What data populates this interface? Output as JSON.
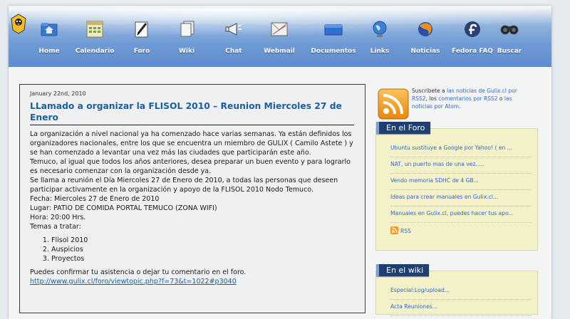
{
  "nav": {
    "items": [
      {
        "label": "Home",
        "icon": "home-icon"
      },
      {
        "label": "Calendario",
        "icon": "calendar-icon"
      },
      {
        "label": "Foro",
        "icon": "pencil-icon"
      },
      {
        "label": "Wiki",
        "icon": "documents-icon"
      },
      {
        "label": "Chat",
        "icon": "megaphone-icon"
      },
      {
        "label": "Webmail",
        "icon": "mail-icon"
      },
      {
        "label": "Documentos",
        "icon": "folder-icon"
      },
      {
        "label": "Links",
        "icon": "globe-icon"
      },
      {
        "label": "Noticias",
        "icon": "firefox-icon"
      },
      {
        "label": "Fedora FAQ",
        "icon": "fedora-icon"
      },
      {
        "label": "Buscar",
        "icon": "binoculars-icon"
      }
    ]
  },
  "post": {
    "date": "January 22nd, 2010",
    "title": "LLamado a organizar la FLISOL 2010 – Reunion Miercoles 27 de Enero",
    "paragraphs": [
      "La organización a nivel nacional ya ha comenzado hace varias semanas. Ya están definidos los organizadores nacionales, entre los que se encuentra un miembro de GULIX ( Camilo Astete ) y se han comenzado a levantar una vez más las ciudades que participarán este año.",
      "Temuco, al igual que todos los años anteriores, desea preparar un buen evento y para lograrlo es necesario comenzar con la organización desde ya.",
      "Se llama a reunión el Día Miercoles 27 de Enero de 2010, a todas las personas que deseen participar activamente en la organización y apoyo de la FLISOL 2010 Nodo Temuco.",
      "Fecha: Miercoles 27 de Enero de 2010",
      "Lugar:  PATIO DE COMIDA PORTAL TEMUCO (ZONA WIFI)",
      "Hora: 20:00 Hrs.",
      "Temas a tratar:"
    ],
    "topics": [
      "Flisol 2010",
      "Auspicios",
      "Proyectos"
    ],
    "closing": "Puedes confirmar tu asistencia  o dejar tu comentario en el foro.",
    "link": "http://www.gulix.cl/foro/viewtopic.php?f=73&t=1022#p3040"
  },
  "subscribe": {
    "prefix": "Suscribete a ",
    "link1": "las noticias de Gulix.cl por RSS2",
    "middle": ", los ",
    "link2": "comentarios por RSS2",
    "middle2": " o ",
    "link3": "las noticias por Atom",
    "suffix": "."
  },
  "foro": {
    "title": "En el Foro",
    "items": [
      "Ubuntu sustituye a Google por Yahoo! ( en ...",
      "NAT, un puerto mas de una vez.....",
      "Vendo memoria SDHC de 4 GB...",
      "Ideas para crear manuales en Gulix.cl...",
      "Manuales en Gulix.cl, puedes hacer tus apo..."
    ],
    "rss_label": "RSS"
  },
  "wiki": {
    "title": "En el wiki",
    "items": [
      "Especial:Log/upload...",
      "Acta Reuniones..."
    ]
  },
  "colors": {
    "nav_blue": "#6f9ad4",
    "link_blue": "#1b5fa3",
    "widget_bg": "#f4f2c8",
    "widget_title": "#1d3f74",
    "rss_orange": "#f39a1c"
  }
}
